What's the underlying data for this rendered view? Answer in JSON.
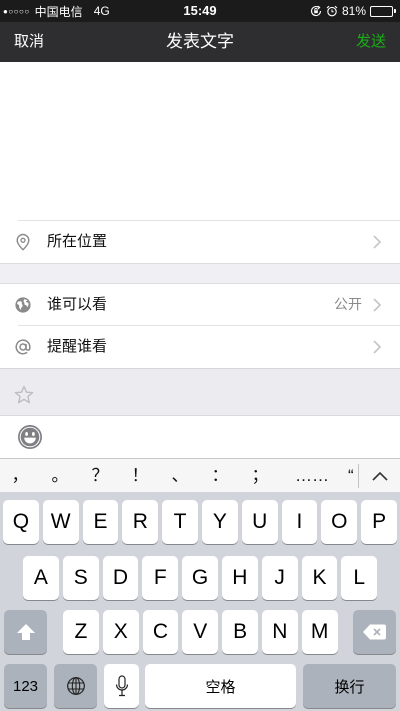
{
  "status_bar": {
    "signal": "●○○○○",
    "carrier": "中国电信",
    "network": "4G",
    "time": "15:49",
    "battery_text": "81%",
    "battery_level": 81,
    "icons": [
      "orientation-lock-icon",
      "alarm-icon",
      "battery-icon"
    ]
  },
  "nav": {
    "cancel_label": "取消",
    "title": "发表文字",
    "send_label": "发送"
  },
  "options": {
    "location": {
      "label": "所在位置",
      "icon": "location-pin-icon"
    },
    "visibility": {
      "label": "谁可以看",
      "value": "公开",
      "icon": "globe-icon"
    },
    "mention": {
      "label": "提醒谁看",
      "icon": "at-icon"
    }
  },
  "toolbar": {
    "icons": [
      "star-icon",
      "emoji-icon"
    ]
  },
  "punctuation": [
    "，",
    "。",
    "？",
    "！",
    "、",
    "：",
    "；",
    "……",
    "“"
  ],
  "keyboard": {
    "row1": [
      "Q",
      "W",
      "E",
      "R",
      "T",
      "Y",
      "U",
      "I",
      "O",
      "P"
    ],
    "row2": [
      "A",
      "S",
      "D",
      "F",
      "G",
      "H",
      "J",
      "K",
      "L"
    ],
    "row3": [
      "Z",
      "X",
      "C",
      "V",
      "B",
      "N",
      "M"
    ],
    "numbers_label": "123",
    "space_label": "空格",
    "return_label": "换行",
    "icons": [
      "shift-icon",
      "delete-icon",
      "globe-icon",
      "microphone-icon",
      "chevron-up-icon"
    ]
  },
  "colors": {
    "nav_background": "#2e2e30",
    "send_accent": "#1aad19",
    "section_background": "#efeff4",
    "keyboard_background": "#d1d5db",
    "special_key": "#abb2bb"
  }
}
